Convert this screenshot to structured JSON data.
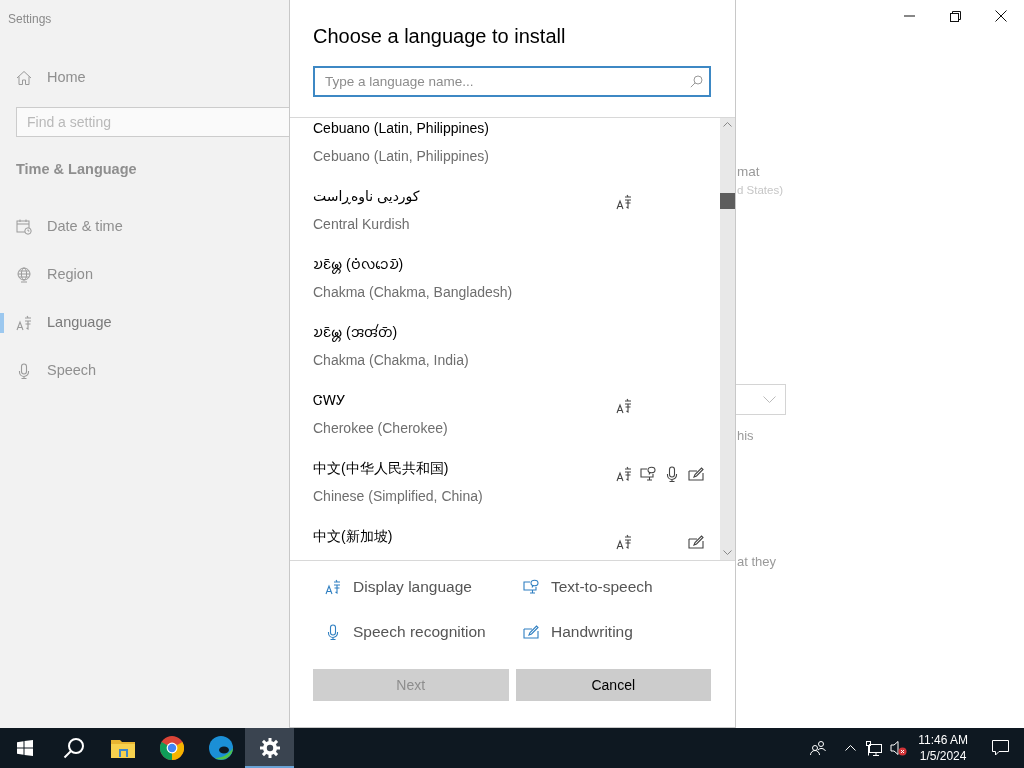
{
  "settings": {
    "title": "Settings",
    "home": "Home",
    "search": {
      "placeholder": "Find a setting"
    },
    "section": "Time & Language",
    "nav": [
      {
        "label": "Date & time",
        "selected": false
      },
      {
        "label": "Region",
        "selected": false
      },
      {
        "label": "Language",
        "selected": true
      },
      {
        "label": "Speech",
        "selected": false
      }
    ],
    "behind": {
      "line_1": "mat",
      "line_2": "d States)",
      "line_3": "his",
      "line_4": "at they"
    }
  },
  "dialog": {
    "title": "Choose a language to install",
    "search": {
      "placeholder": "Type a language name..."
    },
    "languages": [
      {
        "native": "Cebuano (Latin, Philippines)",
        "name": "Cebuano (Latin, Philippines)",
        "display_language": false,
        "text_to_speech": false,
        "speech_recognition": false,
        "handwriting": false
      },
      {
        "native": "کوردیی ناوەڕاست",
        "name": "Central Kurdish",
        "display_language": true,
        "text_to_speech": false,
        "speech_recognition": false,
        "handwriting": false
      },
      {
        "native": "𑄌𑄋𑄴𑄟𑄳𑄦 (𑄝𑄁𑄣𑄘𑄬𑄌𑄴)",
        "name": "Chakma (Chakma, Bangladesh)",
        "display_language": false,
        "text_to_speech": false,
        "speech_recognition": false,
        "handwriting": false
      },
      {
        "native": "𑄌𑄋𑄴𑄟𑄳𑄦 (𑄞𑄢𑄧𑄖𑄴)",
        "name": "Chakma (Chakma, India)",
        "display_language": false,
        "text_to_speech": false,
        "speech_recognition": false,
        "handwriting": false
      },
      {
        "native": "ᏣᎳᎩ",
        "name": "Cherokee (Cherokee)",
        "display_language": true,
        "text_to_speech": false,
        "speech_recognition": false,
        "handwriting": false
      },
      {
        "native": "中文(中华人民共和国)",
        "name": "Chinese (Simplified, China)",
        "display_language": true,
        "text_to_speech": true,
        "speech_recognition": true,
        "handwriting": true
      },
      {
        "native": "中文(新加坡)",
        "display_language": true,
        "text_to_speech": false,
        "speech_recognition": false,
        "handwriting": true
      }
    ],
    "legend": [
      {
        "kind": "display",
        "label": "Display language"
      },
      {
        "kind": "tts",
        "label": "Text-to-speech"
      },
      {
        "kind": "speech",
        "label": "Speech recognition"
      },
      {
        "kind": "handwriting",
        "label": "Handwriting"
      }
    ],
    "buttons": [
      {
        "label": "Next",
        "disabled": true
      },
      {
        "label": "Cancel",
        "disabled": false
      }
    ]
  },
  "taskbar": {
    "apps": [
      {
        "kind": "start",
        "active": false
      },
      {
        "kind": "search",
        "active": false
      },
      {
        "kind": "folder",
        "active": false
      },
      {
        "kind": "chrome",
        "active": false
      },
      {
        "kind": "edge",
        "active": false
      },
      {
        "kind": "settings",
        "active": true
      }
    ],
    "time": "11:46 AM",
    "date": "1/5/2024"
  }
}
